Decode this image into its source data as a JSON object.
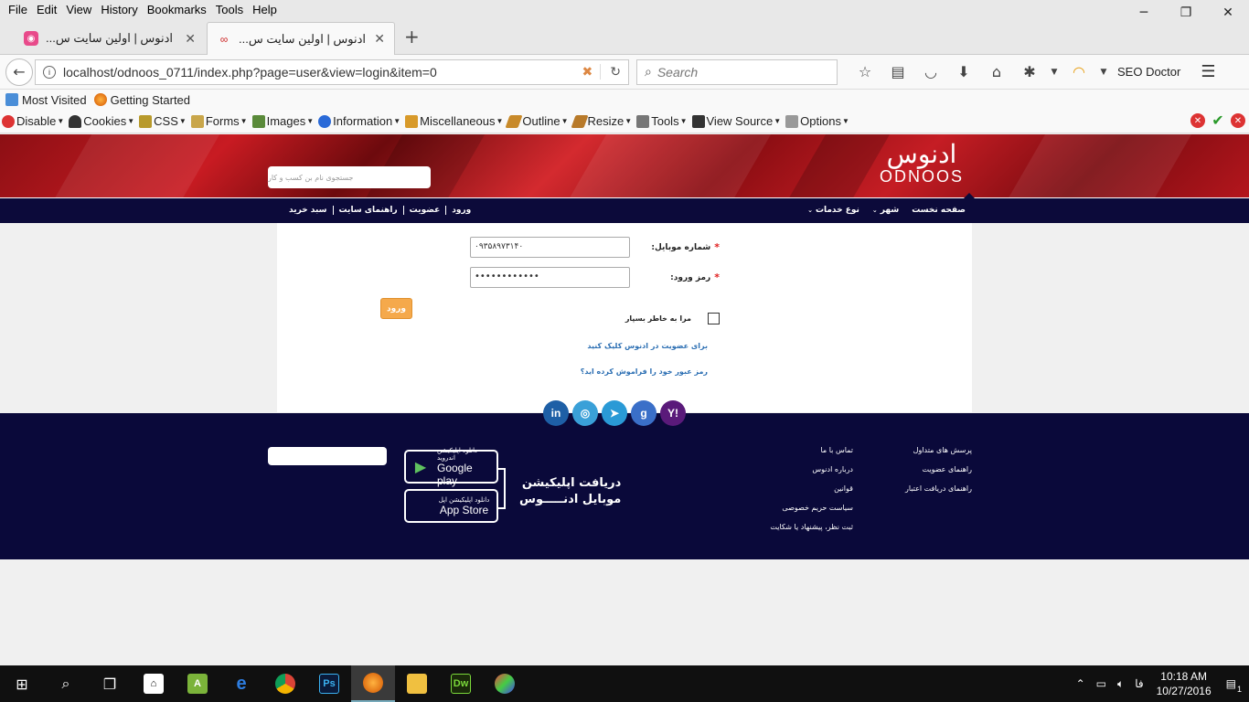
{
  "menubar": [
    "File",
    "Edit",
    "View",
    "History",
    "Bookmarks",
    "Tools",
    "Help"
  ],
  "tabs": [
    {
      "title": "ادنوس | اولین سایت س..."
    },
    {
      "title": "ادنوس | اولین سایت س..."
    }
  ],
  "nav": {
    "url": "localhost/odnoos_0711/index.php?page=user&view=login&item=0",
    "search_placeholder": "Search",
    "seo_doctor": "SEO Doctor"
  },
  "bookmarks": [
    "Most Visited",
    "Getting Started"
  ],
  "devbar": [
    "Disable",
    "Cookies",
    "CSS",
    "Forms",
    "Images",
    "Information",
    "Miscellaneous",
    "Outline",
    "Resize",
    "Tools",
    "View Source",
    "Options"
  ],
  "site": {
    "logo_fa": "ادنوس",
    "logo_en": "ODNOOS",
    "search_placeholder": "جستجوی نام بن کسب و کار",
    "nav_right": [
      "صفحه نخست",
      "شهر",
      "نوع خدمات"
    ],
    "nav_left": [
      "ورود",
      "عضویت",
      "راهنمای سایت",
      "سبد خرید"
    ]
  },
  "form": {
    "mobile_label": "شماره موبایل:",
    "mobile_value": "۰۹۳۵۸۹۷۳۱۴۰",
    "password_label": "رمز ورود:",
    "password_value": "••••••••••••",
    "login_button": "ورود",
    "remember_label": "مرا به خاطر بسپار",
    "signup_link": "برای عضویت در ادنوس کلیک کنید",
    "forgot_link": "رمز عبور خود را فراموش کرده اید؟"
  },
  "socials": [
    "Y!",
    "g",
    "telegram",
    "instagram",
    "in"
  ],
  "footer": {
    "col1": [
      "پرسش های متداول",
      "راهنمای عضویت",
      "راهنمای دریافت اعتبار"
    ],
    "col2": [
      "تماس با ما",
      "درباره ادنوس",
      "قوانین",
      "سیاست حریم خصوصی",
      "ثبت نظر، پیشنهاد یا شکایت"
    ],
    "app_title_1": "دریافت اپلیکیشن",
    "app_title_2": "موبایل ادنـــــوس",
    "google_small": "دانلود اپلیکیشن اندروید",
    "google_big": "Google play",
    "apple_small": "دانلود اپلیکیشن اپل",
    "apple_big": "App Store"
  },
  "taskbar": {
    "lang": "فا",
    "time": "10:18 AM",
    "date": "10/27/2016",
    "notif_count": "1"
  },
  "colors": {
    "banner_red": "#c81b22",
    "nav_navy": "#0c0a3a",
    "login_orange": "#f5a94b",
    "link_blue": "#2c6fb3"
  }
}
